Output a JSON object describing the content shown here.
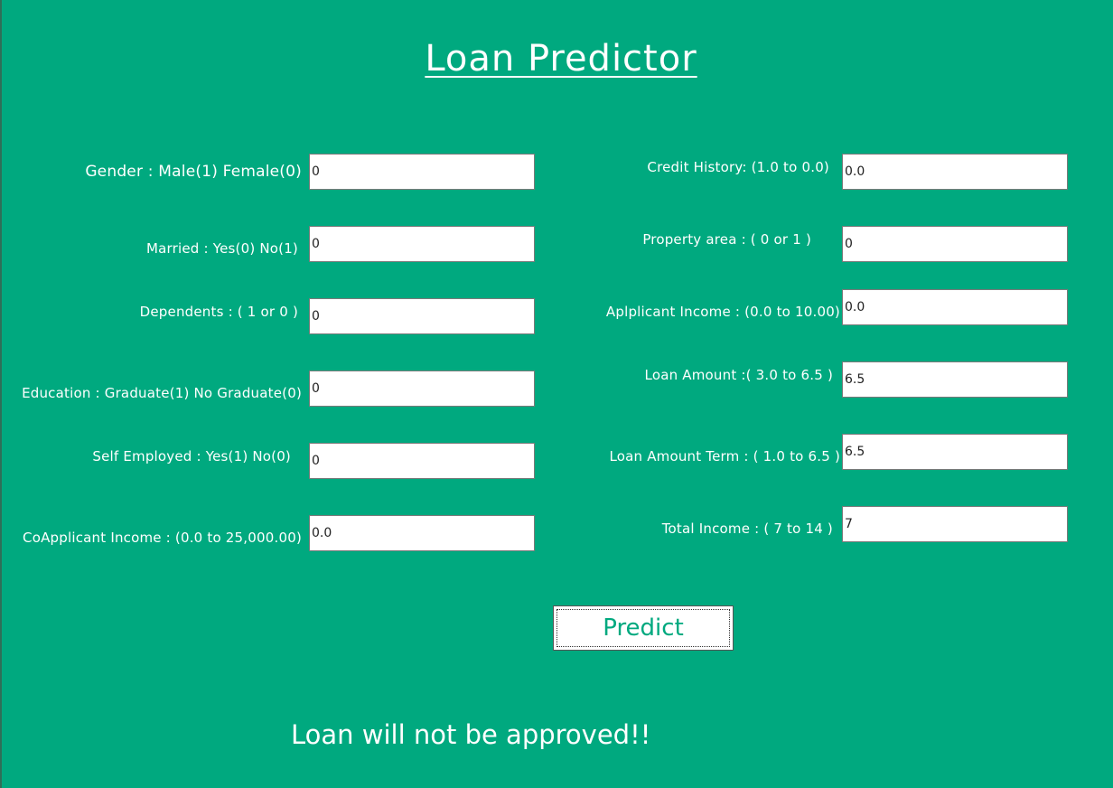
{
  "title": "Loan Predictor",
  "left_fields": [
    {
      "label": "Gender : Male(1)  Female(0)",
      "value": "0"
    },
    {
      "label": "Married : Yes(0)  No(1)",
      "value": "0"
    },
    {
      "label": "Dependents : ( 1 or 0 )",
      "value": "0"
    },
    {
      "label": "Education : Graduate(1) No Graduate(0)",
      "value": "0"
    },
    {
      "label": "Self Employed : Yes(1) No(0)",
      "value": "0"
    },
    {
      "label": "CoApplicant Income : (0.0 to 25,000.00)",
      "value": "0.0"
    }
  ],
  "right_fields": [
    {
      "label": "Credit History: (1.0 to 0.0)",
      "value": "0.0"
    },
    {
      "label": "Property area : ( 0 or 1 )",
      "value": "0"
    },
    {
      "label": "Aplplicant Income : (0.0 to 10.00)",
      "value": "0.0"
    },
    {
      "label": "Loan Amount :( 3.0 to 6.5 )",
      "value": "6.5"
    },
    {
      "label": "Loan Amount Term : ( 1.0 to 6.5 )",
      "value": "6.5"
    },
    {
      "label": "Total Income : ( 7 to 14 )",
      "value": "7"
    }
  ],
  "predict_button": {
    "label": "Predict"
  },
  "result": {
    "text": "Loan will not be approved!!"
  },
  "colors": {
    "background": "#00a97f",
    "text": "#ffffff",
    "button_text": "#00a97f"
  }
}
